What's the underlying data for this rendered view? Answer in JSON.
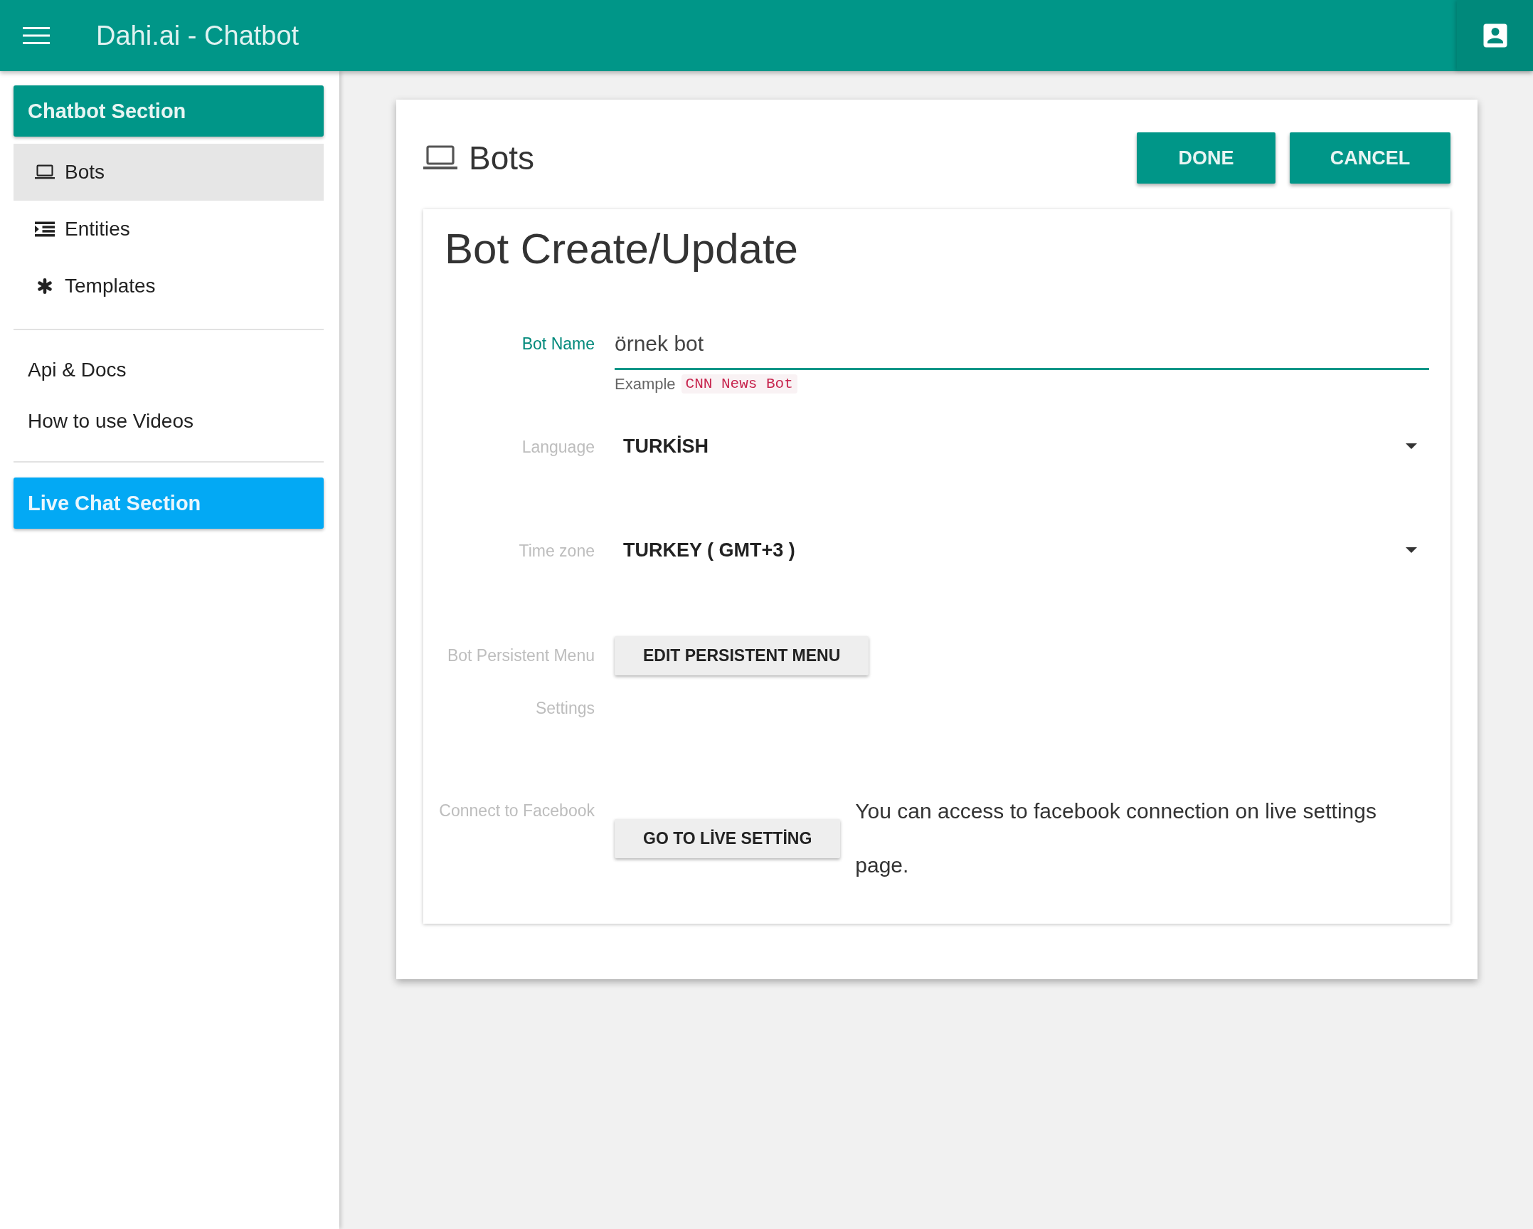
{
  "app_bar": {
    "title": "Dahi.ai - Chatbot"
  },
  "sidebar": {
    "chatbot_section": "Chatbot Section",
    "nav_items": [
      {
        "label": "Bots",
        "selected": true
      },
      {
        "label": "Entities",
        "selected": false
      },
      {
        "label": "Templates",
        "selected": false
      }
    ],
    "links": [
      "Api & Docs",
      "How to use Videos"
    ],
    "live_chat_section": "Live Chat Section"
  },
  "page": {
    "title": "Bots",
    "buttons": [
      "DONE",
      "CANCEL"
    ]
  },
  "form": {
    "title": "Bot Create/Update",
    "rows": [
      {
        "kind": "text",
        "label": "Bot Name",
        "value": "örnek bot",
        "focused": true,
        "hint": "Example",
        "hint_code": "CNN News Bot"
      },
      {
        "kind": "select",
        "label": "Language",
        "value": "TURKİSH"
      },
      {
        "kind": "select",
        "label": "Time zone",
        "value": "TURKEY ( GMT+3 )"
      },
      {
        "kind": "button",
        "label": "Bot Persistent Menu",
        "button": "EDIT PERSISTENT MENU"
      },
      {
        "kind": "label",
        "label": "Settings"
      },
      {
        "kind": "button_note",
        "label": "Connect to Facebook",
        "button": "GO TO LİVE SETTİNG",
        "note": "You can access to facebook connection on live settings page."
      }
    ]
  }
}
